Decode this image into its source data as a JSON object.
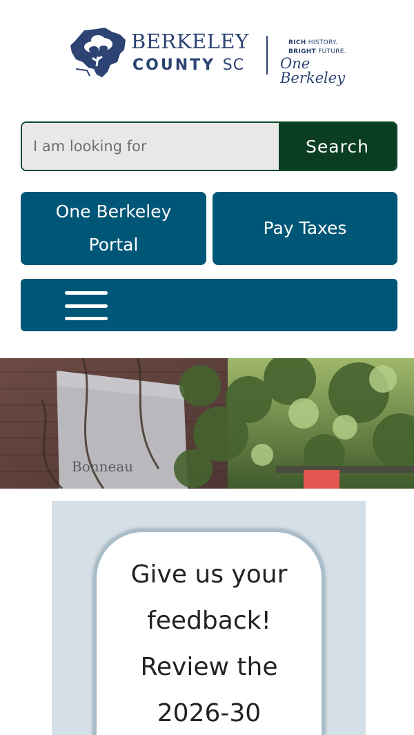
{
  "logo": {
    "name_top": "BERKELEY",
    "name_bottom": "COUNTY",
    "name_state": "SC",
    "tagline_line1_bold": "RICH",
    "tagline_line1_rest": " HISTORY.",
    "tagline_line2_bold": "BRIGHT",
    "tagline_line2_rest": " FUTURE.",
    "script": "One Berkeley",
    "brand_color": "#2d4373"
  },
  "search": {
    "placeholder": "I am looking for",
    "value": "",
    "button_label": "Search",
    "button_color": "#0b3d22"
  },
  "quick_links": {
    "portal_label": "One Berkeley Portal",
    "taxes_label": "Pay Taxes",
    "button_color": "#005677"
  },
  "menu": {
    "icon": "hamburger-menu-icon"
  },
  "hero": {
    "sign_text": "Bonneau"
  },
  "feedback": {
    "lines": [
      "Give us your",
      "feedback!",
      "Review the",
      "2026-30"
    ]
  }
}
